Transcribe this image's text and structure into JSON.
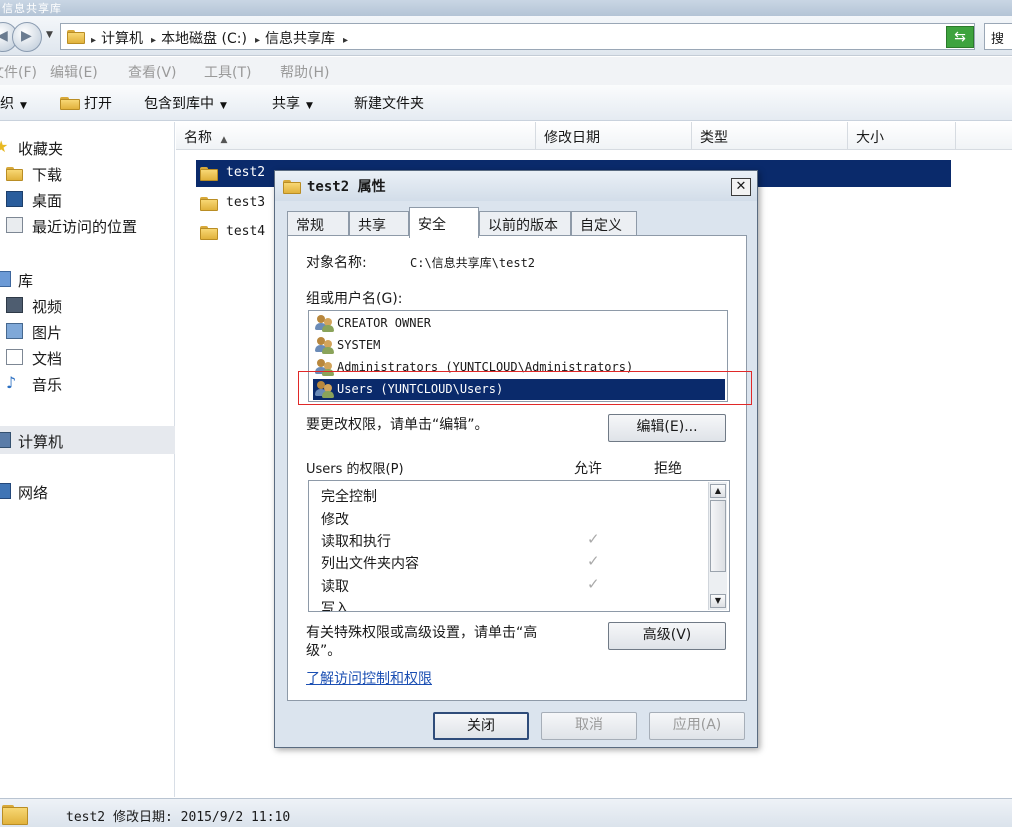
{
  "window": {
    "title": "信息共享库"
  },
  "address": {
    "crumbs": [
      "计算机",
      "本地磁盘 (C:)",
      "信息共享库"
    ],
    "search_text": "搜"
  },
  "menu": [
    "文件(F)",
    "编辑(E)",
    "查看(V)",
    "工具(T)",
    "帮助(H)"
  ],
  "toolbar": {
    "organize": "组织",
    "open": "打开",
    "include": "包含到库中",
    "share": "共享",
    "new_folder": "新建文件夹"
  },
  "nav": {
    "favorites": "收藏夹",
    "downloads": "下载",
    "desktop": "桌面",
    "recent": "最近访问的位置",
    "libraries": "库",
    "videos": "视频",
    "pictures": "图片",
    "documents": "文档",
    "music": "音乐",
    "computer": "计算机",
    "network": "网络"
  },
  "columns": {
    "name": "名称",
    "modified": "修改日期",
    "type": "类型",
    "size": "大小"
  },
  "files": [
    "test2",
    "test3",
    "test4"
  ],
  "status": {
    "text": "test2  修改日期: 2015/9/2 11:10"
  },
  "dialog": {
    "title": "test2 属性",
    "tabs": [
      "常规",
      "共享",
      "安全",
      "以前的版本",
      "自定义"
    ],
    "object_label": "对象名称:",
    "object_value": "C:\\信息共享库\\test2",
    "group_label": "组或用户名(G):",
    "groups": [
      "CREATOR OWNER",
      "SYSTEM",
      "Administrators (YUNTCLOUD\\Administrators)",
      "Users (YUNTCLOUD\\Users)"
    ],
    "change_hint": "要更改权限，请单击“编辑”。",
    "edit_button": "编辑(E)...",
    "perm_label": "Users 的权限(P)",
    "allow": "允许",
    "deny": "拒绝",
    "permissions": [
      {
        "name": "完全控制",
        "allow": ""
      },
      {
        "name": "修改",
        "allow": ""
      },
      {
        "name": "读取和执行",
        "allow": "✓"
      },
      {
        "name": "列出文件夹内容",
        "allow": "✓"
      },
      {
        "name": "读取",
        "allow": "✓"
      },
      {
        "name": "写入",
        "allow": ""
      }
    ],
    "advanced_hint_1": "有关特殊权限或高级设置，请单击“高",
    "advanced_hint_2": "级”。",
    "advanced_button": "高级(V)",
    "learn_link": "了解访问控制和权限",
    "ok": "关闭",
    "cancel": "取消",
    "apply": "应用(A)"
  }
}
